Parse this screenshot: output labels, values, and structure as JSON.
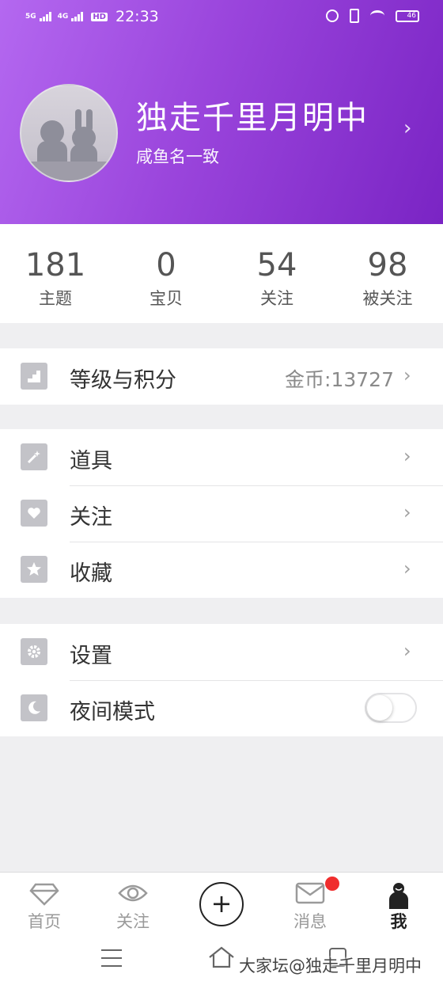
{
  "status_bar": {
    "network1": "5G",
    "network2": "4G",
    "hd": "HD",
    "time": "22:33",
    "battery": "46"
  },
  "profile": {
    "username": "独走千里月明中",
    "signature": "咸鱼名一致"
  },
  "stats": [
    {
      "value": "181",
      "label": "主题"
    },
    {
      "value": "0",
      "label": "宝贝"
    },
    {
      "value": "54",
      "label": "关注"
    },
    {
      "value": "98",
      "label": "被关注"
    }
  ],
  "menu": {
    "level": {
      "label": "等级与积分",
      "value": "金币:13727",
      "icon": "stairs-icon"
    },
    "props": {
      "label": "道具",
      "icon": "magic-wand-icon"
    },
    "follow": {
      "label": "关注",
      "icon": "heart-icon"
    },
    "favorites": {
      "label": "收藏",
      "icon": "star-icon"
    },
    "settings": {
      "label": "设置",
      "icon": "gear-icon"
    },
    "night_mode": {
      "label": "夜间模式",
      "icon": "moon-icon",
      "enabled": false
    }
  },
  "tabbar": {
    "home": "首页",
    "follow": "关注",
    "messages": "消息",
    "me": "我",
    "active": "me"
  },
  "watermark": "大家坛@独走千里月明中",
  "colors": {
    "header_start": "#b468f0",
    "header_end": "#7a24c4",
    "badge": "#f02d2d"
  }
}
